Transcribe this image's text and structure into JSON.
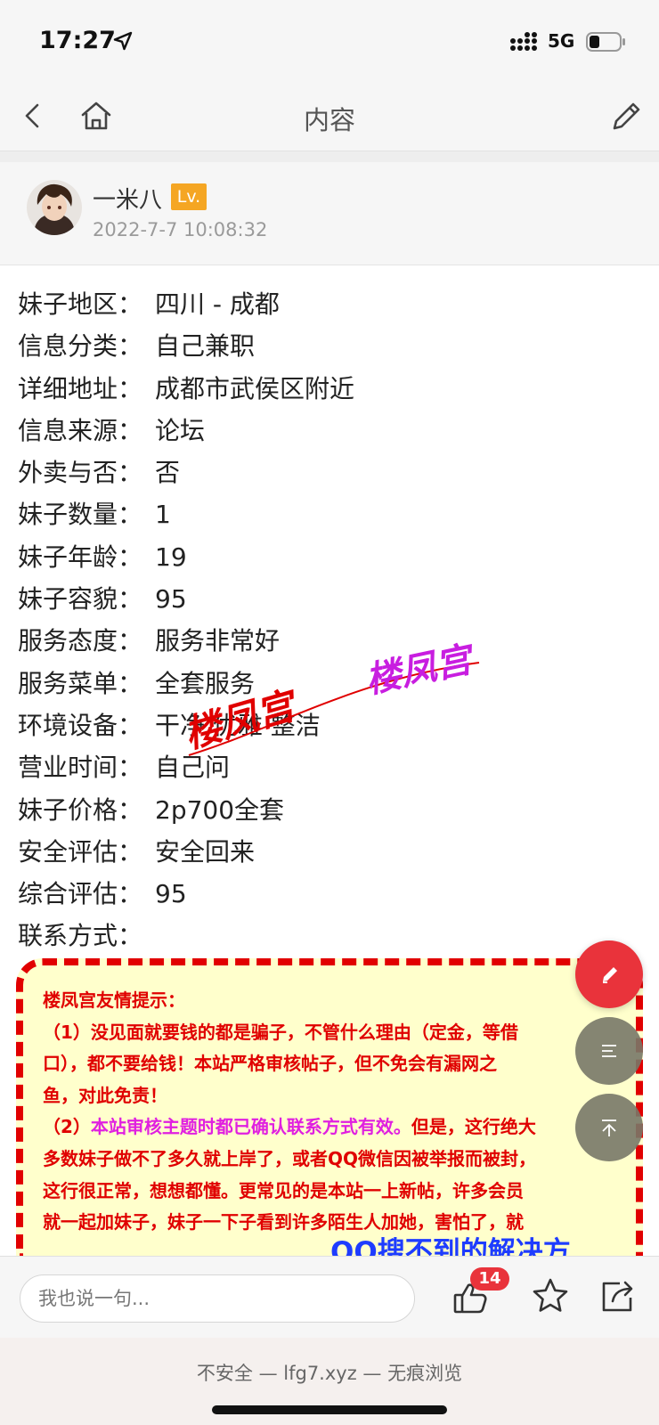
{
  "status_bar": {
    "time": "17:27",
    "network": "5G"
  },
  "nav": {
    "title": "内容"
  },
  "author": {
    "name": "一米八",
    "level": "Lv.",
    "time": "2022-7-7 10:08:32"
  },
  "info": [
    {
      "key": "妹子地区：",
      "value": "四川 - 成都"
    },
    {
      "key": "信息分类：",
      "value": "自己兼职"
    },
    {
      "key": "详细地址：",
      "value": "成都市武侯区附近"
    },
    {
      "key": "信息来源：",
      "value": "论坛"
    },
    {
      "key": "外卖与否：",
      "value": "否"
    },
    {
      "key": "妹子数量：",
      "value": "1"
    },
    {
      "key": "妹子年龄：",
      "value": "19"
    },
    {
      "key": "妹子容貌：",
      "value": "95"
    },
    {
      "key": "服务态度：",
      "value": "服务非常好"
    },
    {
      "key": "服务菜单：",
      "value": "全套服务"
    },
    {
      "key": "环境设备：",
      "value": "干净 优雅 整洁"
    },
    {
      "key": "营业时间：",
      "value": "自己问"
    },
    {
      "key": "妹子价格：",
      "value": "2p700全套"
    },
    {
      "key": "安全评估：",
      "value": "安全回来"
    },
    {
      "key": "综合评估：",
      "value": "95"
    },
    {
      "key": "联系方式：",
      "value": ""
    }
  ],
  "watermark": {
    "text": "楼凤宫"
  },
  "notice": {
    "title": "楼凤宫友情提示：",
    "l1": "（1）没见面就要钱的都是骗子，不管什么理由（定金，等借",
    "l2": "口），都不要给钱！本站严格审核帖子，但不免会有漏网之",
    "l3": "鱼，对此免责！",
    "l4a": "（2）",
    "l4b": "本站审核主题时都已确认联系方式有效。",
    "l4c": "但是，这行绝大",
    "l5": "多数妹子做不了多久就上岸了，或者QQ微信因被举报而被封，",
    "l6": "这行很正常，想想都懂。更常见的是本站一上新帖，许多会员",
    "l7": "就一起加妹子，妹子一下子看到许多陌生人加她，害怕了，就",
    "cut": "QQ搜不到的解决方"
  },
  "bottom": {
    "placeholder": "我也说一句...",
    "like_count": "14"
  },
  "browser": {
    "text": "不安全 — lfg7.xyz — 无痕浏览"
  },
  "colors": {
    "accent_red": "#e9333b",
    "badge_orange": "#f5a623",
    "notice_bg": "#ffffcc",
    "notice_text": "#e00000",
    "notice_magenta": "#e020e0",
    "link_blue": "#1e3cff"
  },
  "icons": [
    "location-arrow-icon",
    "signal-icon",
    "battery-icon",
    "back-icon",
    "home-icon",
    "edit-icon",
    "pencil-icon",
    "list-icon",
    "to-top-icon",
    "thumbs-up-icon",
    "star-icon",
    "share-icon"
  ]
}
